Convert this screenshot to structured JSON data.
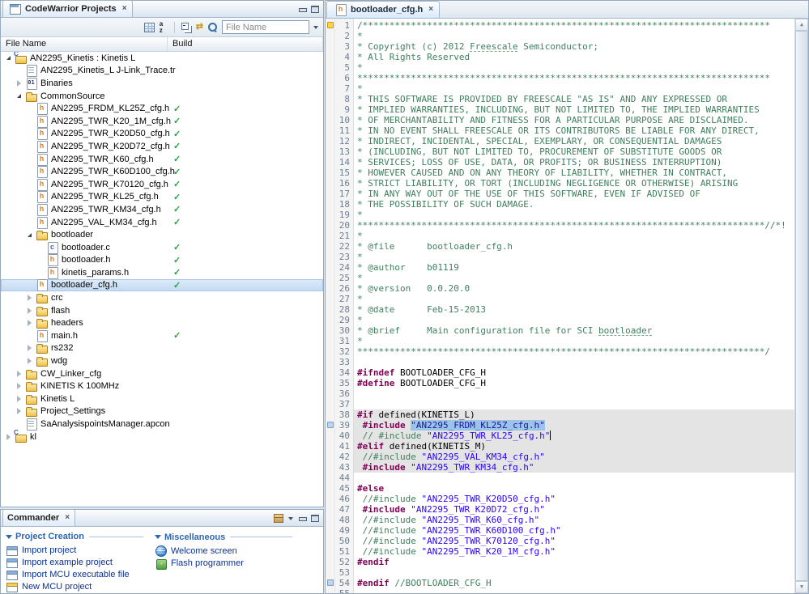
{
  "glyphs": {
    "close": "×",
    "check": "✓",
    "scroll_up": "▲",
    "scroll_down": "▼",
    "link": "⇄"
  },
  "projects_panel": {
    "tab_label": "CodeWarrior Projects",
    "filter_placeholder": "File Name",
    "columns": [
      "File Name",
      "Build"
    ],
    "tree": [
      {
        "l": "AN2295_Kinetis : Kinetis L",
        "lv": 0,
        "ic": "project",
        "ar": "open"
      },
      {
        "l": "AN2295_Kinetis_L J-Link_Trace.tr",
        "lv": 1,
        "ic": "doc"
      },
      {
        "l": "Binaries",
        "lv": 1,
        "ic": "bin",
        "ar": "closed"
      },
      {
        "l": "CommonSource",
        "lv": 1,
        "ic": "folder",
        "ar": "open"
      },
      {
        "l": "AN2295_FRDM_KL25Z_cfg.h",
        "lv": 2,
        "ic": "hfile",
        "ck": true
      },
      {
        "l": "AN2295_TWR_K20_1M_cfg.h",
        "lv": 2,
        "ic": "hfile",
        "ck": true
      },
      {
        "l": "AN2295_TWR_K20D50_cfg.h",
        "lv": 2,
        "ic": "hfile",
        "ck": true
      },
      {
        "l": "AN2295_TWR_K20D72_cfg.h",
        "lv": 2,
        "ic": "hfile",
        "ck": true
      },
      {
        "l": "AN2295_TWR_K60_cfg.h",
        "lv": 2,
        "ic": "hfile",
        "ck": true
      },
      {
        "l": "AN2295_TWR_K60D100_cfg.h",
        "lv": 2,
        "ic": "hfile",
        "ck": true
      },
      {
        "l": "AN2295_TWR_K70120_cfg.h",
        "lv": 2,
        "ic": "hfile",
        "ck": true
      },
      {
        "l": "AN2295_TWR_KL25_cfg.h",
        "lv": 2,
        "ic": "hfile",
        "ck": true
      },
      {
        "l": "AN2295_TWR_KM34_cfg.h",
        "lv": 2,
        "ic": "hfile",
        "ck": true
      },
      {
        "l": "AN2295_VAL_KM34_cfg.h",
        "lv": 2,
        "ic": "hfile",
        "ck": true
      },
      {
        "l": "bootloader",
        "lv": 2,
        "ic": "folder",
        "ar": "open"
      },
      {
        "l": "bootloader.c",
        "lv": 3,
        "ic": "cfile",
        "ck": true
      },
      {
        "l": "bootloader.h",
        "lv": 3,
        "ic": "hfile",
        "ck": true
      },
      {
        "l": "kinetis_params.h",
        "lv": 3,
        "ic": "hfile",
        "ck": true
      },
      {
        "l": "bootloader_cfg.h",
        "lv": 2,
        "ic": "hfile",
        "ck": true,
        "sel": true
      },
      {
        "l": "crc",
        "lv": 2,
        "ic": "folder",
        "ar": "closed"
      },
      {
        "l": "flash",
        "lv": 2,
        "ic": "folder",
        "ar": "closed"
      },
      {
        "l": "headers",
        "lv": 2,
        "ic": "folder",
        "ar": "closed"
      },
      {
        "l": "main.h",
        "lv": 2,
        "ic": "hfile",
        "ck": true
      },
      {
        "l": "rs232",
        "lv": 2,
        "ic": "folder",
        "ar": "closed"
      },
      {
        "l": "wdg",
        "lv": 2,
        "ic": "folder",
        "ar": "closed"
      },
      {
        "l": "CW_Linker_cfg",
        "lv": 1,
        "ic": "folder",
        "ar": "closed"
      },
      {
        "l": "KINETIS K 100MHz",
        "lv": 1,
        "ic": "folder",
        "ar": "closed"
      },
      {
        "l": "Kinetis L",
        "lv": 1,
        "ic": "folder",
        "ar": "closed"
      },
      {
        "l": "Project_Settings",
        "lv": 1,
        "ic": "folder",
        "ar": "closed"
      },
      {
        "l": "SaAnalysispointsManager.apcon",
        "lv": 1,
        "ic": "doc"
      },
      {
        "l": "kl",
        "lv": 0,
        "ic": "project",
        "ar": "closed"
      }
    ]
  },
  "commander_panel": {
    "tab_label": "Commander",
    "sections": [
      {
        "title": "Project Creation",
        "items": [
          {
            "label": "Import project",
            "icon": "import-project"
          },
          {
            "label": "Import example project",
            "icon": "import-example"
          },
          {
            "label": "Import MCU executable file",
            "icon": "import-executable"
          },
          {
            "label": "New MCU project",
            "icon": "new-project"
          }
        ]
      },
      {
        "title": "Miscellaneous",
        "items": [
          {
            "label": "Welcome screen",
            "icon": "welcome-globe"
          },
          {
            "label": "Flash programmer",
            "icon": "flash-programmer"
          }
        ]
      }
    ]
  },
  "editor": {
    "tab_label": "bootloader_cfg.h",
    "markers": [
      {
        "line": 1,
        "type": "task"
      },
      {
        "line": 39,
        "type": "nav"
      },
      {
        "line": 54,
        "type": "nav"
      }
    ],
    "lines": [
      {
        "t": [
          [
            "c",
            "/****************************************************************************"
          ]
        ]
      },
      {
        "t": [
          [
            "c",
            "*"
          ]
        ]
      },
      {
        "t": [
          [
            "c",
            "* Copyright (c) 2012 "
          ],
          [
            "cu",
            "Freescale"
          ],
          [
            "c",
            " Semiconductor;"
          ]
        ]
      },
      {
        "t": [
          [
            "c",
            "* All Rights Reserved"
          ]
        ]
      },
      {
        "t": [
          [
            "c",
            "*"
          ]
        ]
      },
      {
        "t": [
          [
            "c",
            "*****************************************************************************"
          ]
        ]
      },
      {
        "t": [
          [
            "c",
            "*"
          ]
        ]
      },
      {
        "t": [
          [
            "c",
            "* THIS SOFTWARE IS PROVIDED BY FREESCALE \"AS IS\" AND ANY EXPRESSED OR"
          ]
        ]
      },
      {
        "t": [
          [
            "c",
            "* IMPLIED WARRANTIES, INCLUDING, BUT NOT LIMITED TO, THE IMPLIED WARRANTIES"
          ]
        ]
      },
      {
        "t": [
          [
            "c",
            "* OF MERCHANTABILITY AND FITNESS FOR A PARTICULAR PURPOSE ARE DISCLAIMED."
          ]
        ]
      },
      {
        "t": [
          [
            "c",
            "* IN NO EVENT SHALL FREESCALE OR ITS CONTRIBUTORS BE LIABLE FOR ANY DIRECT,"
          ]
        ]
      },
      {
        "t": [
          [
            "c",
            "* INDIRECT, INCIDENTAL, SPECIAL, EXEMPLARY, OR CONSEQUENTIAL DAMAGES"
          ]
        ]
      },
      {
        "t": [
          [
            "c",
            "* (INCLUDING, BUT NOT LIMITED TO, PROCUREMENT OF SUBSTITUTE GOODS OR"
          ]
        ]
      },
      {
        "t": [
          [
            "c",
            "* SERVICES; LOSS OF USE, DATA, OR PROFITS; OR BUSINESS INTERRUPTION)"
          ]
        ]
      },
      {
        "t": [
          [
            "c",
            "* HOWEVER CAUSED AND ON ANY THEORY OF LIABILITY, WHETHER IN CONTRACT,"
          ]
        ]
      },
      {
        "t": [
          [
            "c",
            "* STRICT LIABILITY, OR TORT (INCLUDING NEGLIGENCE OR OTHERWISE) ARISING"
          ]
        ]
      },
      {
        "t": [
          [
            "c",
            "* IN ANY WAY OUT OF THE USE OF THIS SOFTWARE, EVEN IF ADVISED OF"
          ]
        ]
      },
      {
        "t": [
          [
            "c",
            "* THE POSSIBILITY OF SUCH DAMAGE."
          ]
        ]
      },
      {
        "t": [
          [
            "c",
            "*"
          ]
        ]
      },
      {
        "t": [
          [
            "c",
            "****************************************************************************//*!"
          ]
        ]
      },
      {
        "t": [
          [
            "c",
            "*"
          ]
        ]
      },
      {
        "t": [
          [
            "c",
            "* @file      bootloader_cfg.h"
          ]
        ]
      },
      {
        "t": [
          [
            "c",
            "*"
          ]
        ]
      },
      {
        "t": [
          [
            "c",
            "* @author    b01119"
          ]
        ]
      },
      {
        "t": [
          [
            "c",
            "*"
          ]
        ]
      },
      {
        "t": [
          [
            "c",
            "* @version   0.0.20.0"
          ]
        ]
      },
      {
        "t": [
          [
            "c",
            "*"
          ]
        ]
      },
      {
        "t": [
          [
            "c",
            "* @date      Feb-15-2013"
          ]
        ]
      },
      {
        "t": [
          [
            "c",
            "*"
          ]
        ]
      },
      {
        "t": [
          [
            "c",
            "* @brief     Main configuration file for SCI "
          ],
          [
            "cu",
            "bootloader"
          ]
        ]
      },
      {
        "t": [
          [
            "c",
            "*"
          ]
        ]
      },
      {
        "t": [
          [
            "c",
            "****************************************************************************/"
          ]
        ]
      },
      {
        "t": []
      },
      {
        "t": [
          [
            "d",
            "#ifndef"
          ],
          [
            "p",
            " BOOTLOADER_CFG_H"
          ]
        ]
      },
      {
        "t": [
          [
            "d",
            "#define"
          ],
          [
            "p",
            " BOOTLOADER_CFG_H"
          ]
        ]
      },
      {
        "t": []
      },
      {
        "t": []
      },
      {
        "hl": true,
        "t": [
          [
            "d",
            "#if"
          ],
          [
            "p",
            " defined(KINETIS_L)"
          ]
        ]
      },
      {
        "hl": true,
        "t": [
          [
            "p",
            " "
          ],
          [
            "d",
            "#include"
          ],
          [
            "p",
            " "
          ],
          [
            "ss",
            "\"AN2295_FRDM_KL25Z_cfg.h\""
          ]
        ]
      },
      {
        "hl": true,
        "cursor": true,
        "t": [
          [
            "p",
            " "
          ],
          [
            "c",
            "// #include "
          ],
          [
            "s",
            "\"AN2295_TWR_KL25_cfg.h\""
          ]
        ]
      },
      {
        "hl": true,
        "t": [
          [
            "d",
            "#elif"
          ],
          [
            "p",
            " defined(KINETIS_M)"
          ]
        ]
      },
      {
        "hl": true,
        "t": [
          [
            "p",
            " "
          ],
          [
            "c",
            "//#include "
          ],
          [
            "s",
            "\"AN2295_VAL_KM34_cfg.h\""
          ]
        ]
      },
      {
        "hl": true,
        "t": [
          [
            "p",
            " "
          ],
          [
            "d",
            "#include"
          ],
          [
            "p",
            " "
          ],
          [
            "s",
            "\"AN2295_TWR_KM34_cfg.h\""
          ]
        ]
      },
      {
        "t": []
      },
      {
        "t": [
          [
            "d",
            "#else"
          ]
        ]
      },
      {
        "t": [
          [
            "p",
            " "
          ],
          [
            "c",
            "//#include "
          ],
          [
            "s",
            "\"AN2295_TWR_K20D50_cfg.h\""
          ]
        ]
      },
      {
        "t": [
          [
            "p",
            " "
          ],
          [
            "d",
            "#include"
          ],
          [
            "p",
            " "
          ],
          [
            "s",
            "\"AN2295_TWR_K20D72_cfg.h\""
          ]
        ]
      },
      {
        "t": [
          [
            "p",
            " "
          ],
          [
            "c",
            "//#include "
          ],
          [
            "s",
            "\"AN2295_TWR_K60_cfg.h\""
          ]
        ]
      },
      {
        "t": [
          [
            "p",
            " "
          ],
          [
            "c",
            "//#include "
          ],
          [
            "s",
            "\"AN2295_TWR_K60D100_cfg.h\""
          ]
        ]
      },
      {
        "t": [
          [
            "p",
            " "
          ],
          [
            "c",
            "//#include "
          ],
          [
            "s",
            "\"AN2295_TWR_K70120_cfg.h\""
          ]
        ]
      },
      {
        "t": [
          [
            "p",
            " "
          ],
          [
            "c",
            "//#include "
          ],
          [
            "s",
            "\"AN2295_TWR_K20_1M_cfg.h\""
          ]
        ]
      },
      {
        "t": [
          [
            "d",
            "#endif"
          ]
        ]
      },
      {
        "t": []
      },
      {
        "t": [
          [
            "d",
            "#endif"
          ],
          [
            "c",
            " //BOOTLOADER_CFG_H"
          ]
        ]
      },
      {
        "t": []
      }
    ]
  }
}
